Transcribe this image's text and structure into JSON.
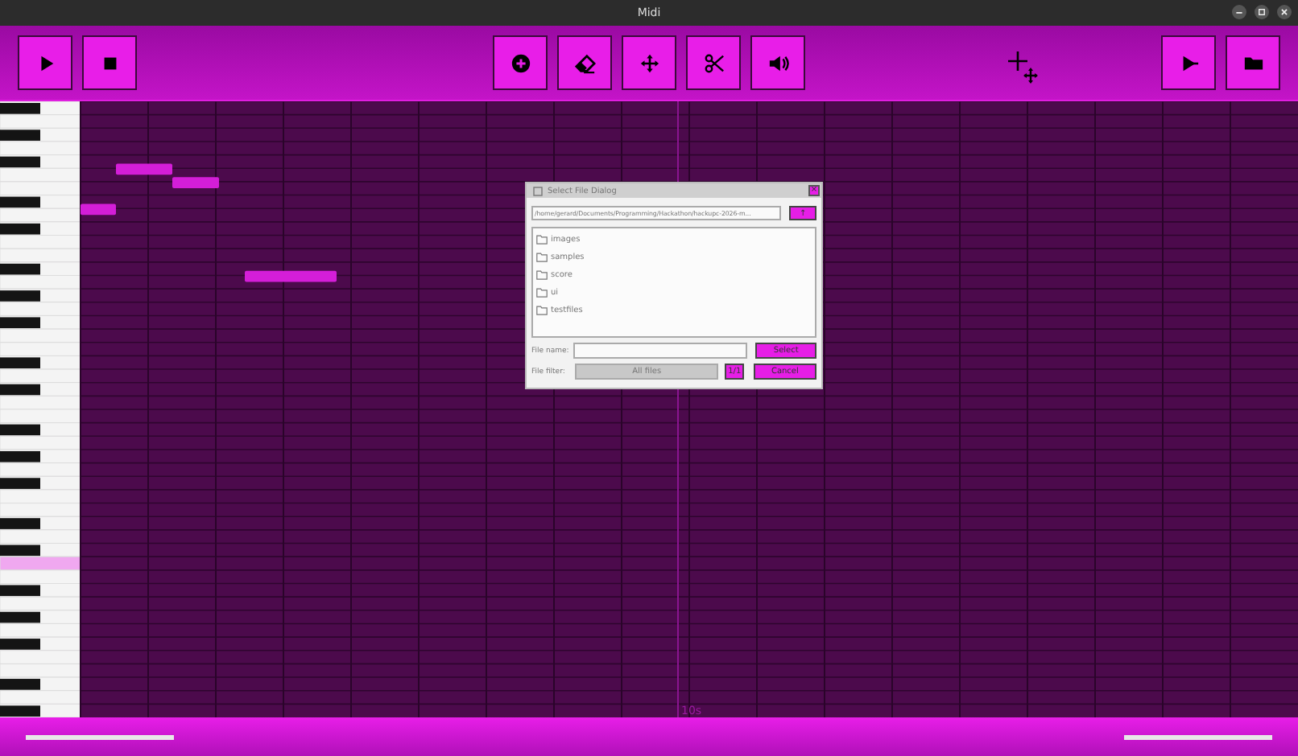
{
  "window": {
    "title": "Midi"
  },
  "toolbar": {
    "left": [
      {
        "kind": "play"
      },
      {
        "kind": "stop"
      }
    ],
    "middle": [
      {
        "kind": "add"
      },
      {
        "kind": "erase"
      },
      {
        "kind": "move"
      },
      {
        "kind": "cut"
      },
      {
        "kind": "volume"
      }
    ],
    "right": [
      {
        "kind": "play-all"
      },
      {
        "kind": "open"
      }
    ]
  },
  "piano_roll": {
    "playhead_label": "10s"
  },
  "dialog": {
    "title": "Select File Dialog",
    "close": "×",
    "path": "/home/gerard/Documents/Programming/Hackathon/hackupc-2026-m...",
    "up_button": "↑",
    "entries": [
      "images",
      "samples",
      "score",
      "ui",
      "testfiles"
    ],
    "file_name_label": "File name:",
    "select_button": "Select",
    "file_filter_label": "File filter:",
    "filter_value": "All files",
    "page": "1/1",
    "cancel_button": "Cancel"
  },
  "footer": {
    "sliders": [
      {
        "level": 1
      },
      {
        "level": 1
      }
    ]
  }
}
